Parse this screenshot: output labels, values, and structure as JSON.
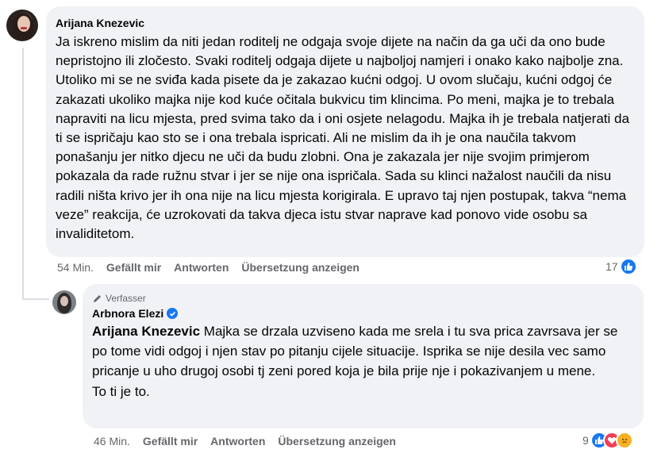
{
  "comment": {
    "author": "Arijana Knezevic",
    "text": "Ja iskreno mislim da niti jedan roditelj ne odgaja svoje dijete na način da ga uči da ono bude nepristojno ili zločesto. Svaki roditelj odgaja dijete u najboljoj namjeri i onako kako najbolje zna. Utoliko mi se ne sviđa kada pisete da je zakazao kućni odgoj. U ovom slučaju, kućni odgoj će zakazati ukoliko majka nije kod kuće očitala bukvicu tim klincima. Po meni, majka je to trebala napraviti na licu mjesta, pred svima tako da i oni osjete nelagodu. Majka ih je trebala natjerati da ti se ispričaju kao sto se i ona trebala ispricati. Ali ne mislim da ih je ona naučila takvom ponašanju jer nitko djecu ne uči da budu zlobni. Ona je zakazala jer nije svojim primjerom pokazala da rade ružnu stvar i jer se nije ona ispričala. Sada su klinci nažalost naučili da nisu radili ništa krivo jer ih ona nije na licu mjesta korigirala. E upravo taj njen postupak, takva “nema veze” reakcija, će uzrokovati da takva djeca istu stvar naprave kad ponovo vide osobu sa invaliditetom.",
    "time": "54 Min.",
    "like_label": "Gefällt mir",
    "reply_label": "Antworten",
    "translate_label": "Übersetzung anzeigen",
    "reaction_count": "17"
  },
  "reply": {
    "badge": "Verfasser",
    "author": "Arbnora Elezi",
    "mention": "Arijana Knezevic",
    "text": " Majka se drzala uzviseno kada me srela i tu sva prica zavrsava jer se po tome vidi odgoj i njen stav po pitanju cijele situacije. Isprika se nije desila vec samo pricanje u uho drugoj osobi tj zeni pored koja je bila prije nje i pokazivanjem u mene.",
    "text2": "To ti je to.",
    "time": "46 Min.",
    "like_label": "Gefällt mir",
    "reply_label": "Antworten",
    "translate_label": "Übersetzung anzeigen",
    "reaction_count": "9"
  },
  "colors": {
    "bubble": "#f0f2f5",
    "meta": "#65676b",
    "like": "#1877f2",
    "love": "#f33e58",
    "care": "#f7b125"
  }
}
